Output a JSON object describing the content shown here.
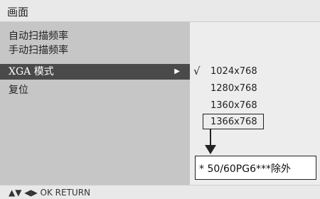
{
  "header": {
    "title": "画面"
  },
  "menu": {
    "items": [
      {
        "label": "自动扫描频率"
      },
      {
        "label": "手动扫描频率"
      },
      {
        "label": "XGA 模式",
        "selected": true
      },
      {
        "label": "复位"
      }
    ],
    "submenu_arrow_icon": "triangle-right-icon"
  },
  "options": {
    "items": [
      {
        "label": "1024x768",
        "checked": true
      },
      {
        "label": "1280x768"
      },
      {
        "label": "1360x768"
      },
      {
        "label": "1366x768",
        "outlined": true
      }
    ],
    "check_icon": "checkmark-icon"
  },
  "note": {
    "text": "* 50/60PG6***除外"
  },
  "footer": {
    "hint": "▲▼ ◀▶  OK  RETURN"
  },
  "colors": {
    "selected_background": "#4a4a4a",
    "left_panel": "#c6c6c6",
    "right_panel": "#ededed"
  }
}
